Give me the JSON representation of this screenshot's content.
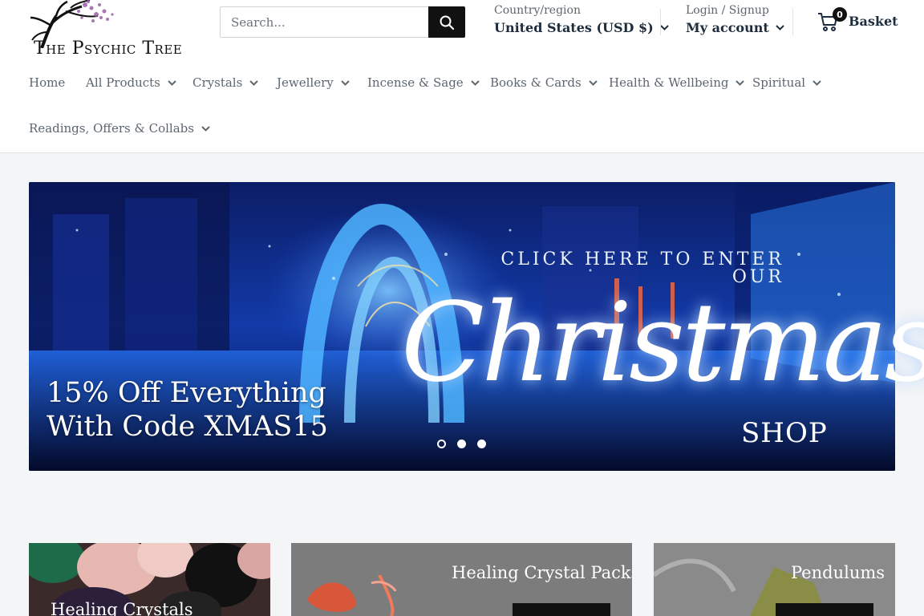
{
  "brand": {
    "logo_text": "The Psychic Tree"
  },
  "search": {
    "placeholder": "Search..."
  },
  "country": {
    "label": "Country/region",
    "value": "United States (USD $)"
  },
  "account": {
    "label": "Login / Signup",
    "value": "My account"
  },
  "basket": {
    "count": "0",
    "label": "Basket"
  },
  "nav": {
    "items": [
      {
        "label": "Home"
      },
      {
        "label": "All Products"
      },
      {
        "label": "Crystals"
      },
      {
        "label": "Jewellery"
      },
      {
        "label": "Incense & Sage"
      },
      {
        "label": "Books & Cards"
      },
      {
        "label": "Health & Wellbeing"
      },
      {
        "label": "Spiritual"
      },
      {
        "label": "Readings, Offers & Collabs"
      }
    ]
  },
  "hero": {
    "enter_line1": "CLICK HERE TO ENTER",
    "enter_line2": "OUR",
    "script": "Christmas",
    "shop": "SHOP",
    "offer_line1": "15% Off Everything",
    "offer_line2": "With Code XMAS15",
    "slides": 3,
    "active_slide": 1
  },
  "categories": [
    {
      "title": "Healing Crystals"
    },
    {
      "title": "Healing Crystal Packs"
    },
    {
      "title": "Pendulums"
    }
  ],
  "colors": {
    "header_bg": "#ffffff",
    "page_bg": "#f3f5f6",
    "text": "#1e2d3d",
    "button": "#111111"
  }
}
